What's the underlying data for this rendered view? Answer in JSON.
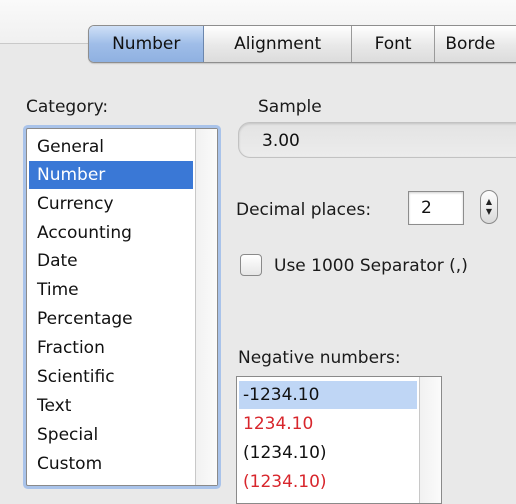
{
  "tabs": [
    {
      "label": "Number",
      "selected": true
    },
    {
      "label": "Alignment",
      "selected": false
    },
    {
      "label": "Font",
      "selected": false
    },
    {
      "label": "Borde",
      "selected": false
    }
  ],
  "category": {
    "label": "Category:",
    "items": [
      "General",
      "Number",
      "Currency",
      "Accounting",
      "Date",
      "Time",
      "Percentage",
      "Fraction",
      "Scientific",
      "Text",
      "Special",
      "Custom"
    ],
    "selected": "Number"
  },
  "sample": {
    "label": "Sample",
    "value": "3.00"
  },
  "decimal_places": {
    "label": "Decimal places:",
    "value": "2"
  },
  "separator": {
    "label": "Use 1000 Separator (,)",
    "checked": false
  },
  "negative_numbers": {
    "label": "Negative numbers:",
    "items": [
      {
        "text": "-1234.10",
        "color": "#111111",
        "selected": true
      },
      {
        "text": "1234.10",
        "color": "#d8262c",
        "selected": false
      },
      {
        "text": "(1234.10)",
        "color": "#111111",
        "selected": false
      },
      {
        "text": "(1234.10)",
        "color": "#d8262c",
        "selected": false
      }
    ]
  },
  "colors": {
    "selection": "#3a78d6",
    "negative_red": "#d8262c"
  }
}
